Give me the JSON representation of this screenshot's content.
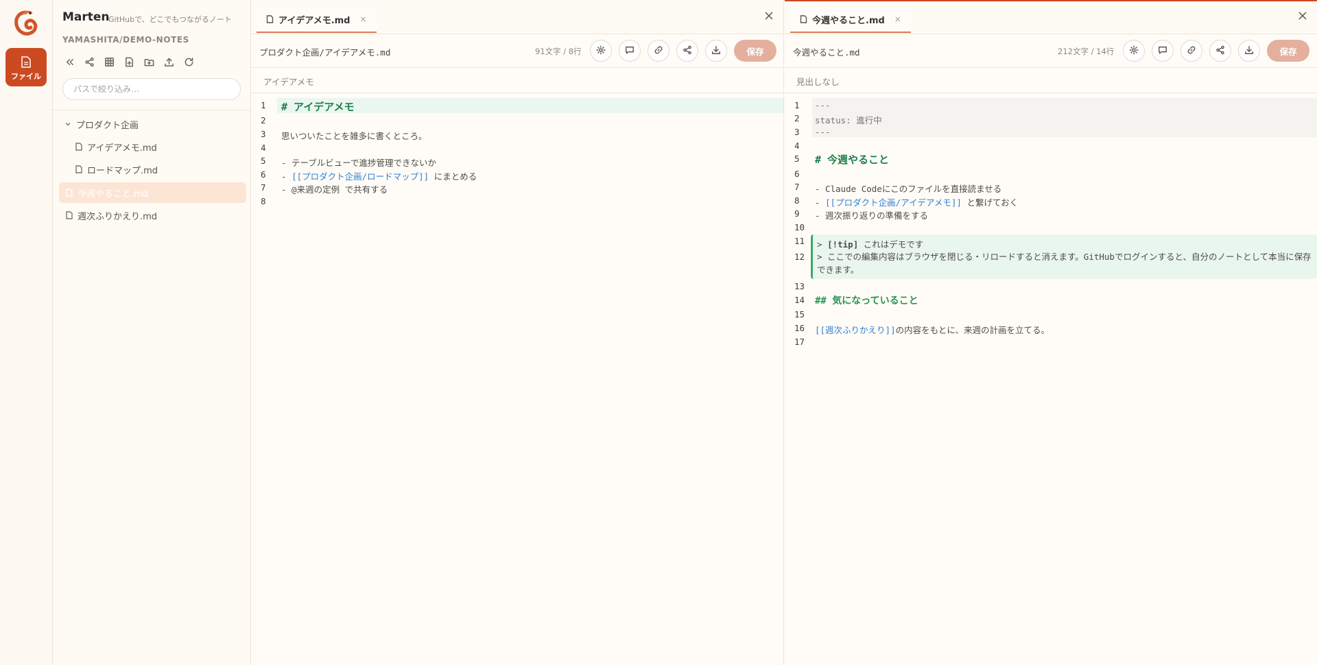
{
  "app": {
    "title": "Marten",
    "tagline": "GitHubで、どこでもつながるノート",
    "repo": "YAMASHITA/DEMO-NOTES",
    "files_label": "ファイル",
    "brand_color": "#cc4a22"
  },
  "sidebar": {
    "tools": [
      "collapse-icon",
      "share-icon",
      "table-icon",
      "new-file-icon",
      "new-folder-icon",
      "upload-icon",
      "refresh-icon"
    ],
    "filter_placeholder": "パスで絞り込み…",
    "tree": [
      {
        "label": "プロダクト企画",
        "type": "folder",
        "expanded": true
      },
      {
        "label": "アイデアメモ.md",
        "type": "file"
      },
      {
        "label": "ロードマップ.md",
        "type": "file"
      },
      {
        "label": "今週やること.md",
        "type": "file",
        "active": true
      },
      {
        "label": "週次ふりかえり.md",
        "type": "file"
      }
    ]
  },
  "left_pane": {
    "tab": "アイデアメモ.md",
    "tab_close": "×",
    "path": "プロダクト企画/アイデアメモ.md",
    "stats": "91文字 / 8行",
    "save_label": "保存",
    "heading": "アイデアメモ",
    "lines": [
      {
        "n": "1",
        "text": "# アイデアメモ"
      },
      {
        "n": "2",
        "text": ""
      },
      {
        "n": "3",
        "text": "思いついたことを雑多に書くところ。"
      },
      {
        "n": "4",
        "text": ""
      },
      {
        "n": "5",
        "text": "- テーブルビューで進捗管理できないか"
      },
      {
        "n": "6",
        "prefix": "- ",
        "link": "[[プロダクト企画/ロードマップ]]",
        "suffix": " にまとめる"
      },
      {
        "n": "7",
        "text": "- @来週の定例 で共有する"
      },
      {
        "n": "8",
        "text": ""
      }
    ]
  },
  "right_pane": {
    "tab": "今週やること.md",
    "tab_close": "×",
    "path": "今週やること.md",
    "stats": "212文字 / 14行",
    "save_label": "保存",
    "heading": "見出しなし",
    "lines": [
      {
        "n": "1",
        "text": "---"
      },
      {
        "n": "2",
        "text": "status: 進行中"
      },
      {
        "n": "3",
        "text": "---"
      },
      {
        "n": "4",
        "text": ""
      },
      {
        "n": "5",
        "text": "# 今週やること"
      },
      {
        "n": "6",
        "text": ""
      },
      {
        "n": "7",
        "text": "- Claude Codeにこのファイルを直接読ませる"
      },
      {
        "n": "8",
        "prefix": "- ",
        "link": "[[プロダクト企画/アイデアメモ]]",
        "suffix": " と繋げておく"
      },
      {
        "n": "9",
        "text": "- 週次振り返りの準備をする"
      },
      {
        "n": "10",
        "text": ""
      },
      {
        "n": "11",
        "prefix": "> ",
        "bold": "[!tip]",
        "suffix": " これはデモです"
      },
      {
        "n": "12",
        "text": "> ここでの編集内容はブラウザを閉じる・リロードすると消えます。GitHubでログインすると、自分のノートとして本当に保存できます。"
      },
      {
        "n": "13",
        "text": ""
      },
      {
        "n": "14",
        "text": "## 気になっていること"
      },
      {
        "n": "15",
        "text": ""
      },
      {
        "n": "16",
        "link": "[[週次ふりかえり]]",
        "suffix": "の内容をもとに、来週の計画を立てる。"
      },
      {
        "n": "17",
        "text": ""
      }
    ]
  },
  "toolbar_icons": [
    "gear-icon",
    "comment-icon",
    "link-icon",
    "share-icon",
    "download-icon"
  ]
}
